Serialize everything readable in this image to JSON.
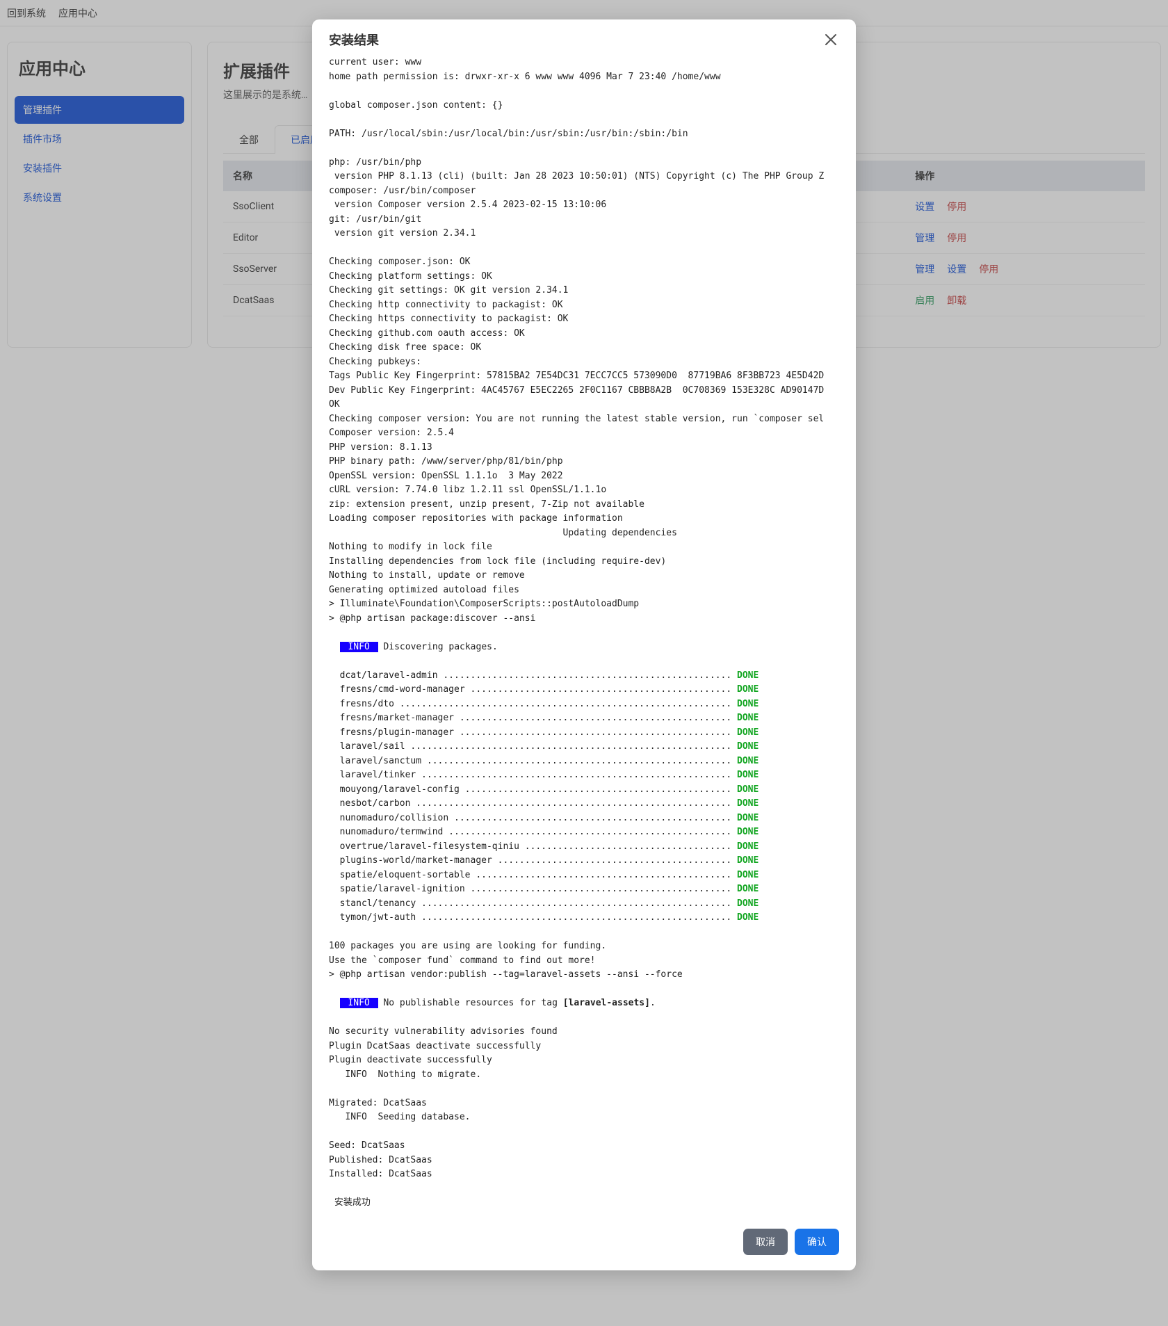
{
  "topbar": {
    "back": "回到系统",
    "app_center": "应用中心"
  },
  "sidebar": {
    "title": "应用中心",
    "items": [
      "管理插件",
      "插件市场",
      "安装插件",
      "系统设置"
    ]
  },
  "content": {
    "title": "扩展插件",
    "desc": "这里展示的是系统…",
    "tabs": [
      "全部",
      "已启用"
    ],
    "table": {
      "headers": [
        "名称",
        "操作"
      ],
      "rows": [
        {
          "name": "SsoClient",
          "ops": [
            {
              "label": "设置",
              "cls": "op-blue"
            },
            {
              "label": "停用",
              "cls": "op-red"
            }
          ]
        },
        {
          "name": "Editor",
          "ops": [
            {
              "label": "管理",
              "cls": "op-blue"
            },
            {
              "label": "停用",
              "cls": "op-red"
            }
          ]
        },
        {
          "name": "SsoServer",
          "ops": [
            {
              "label": "管理",
              "cls": "op-blue"
            },
            {
              "label": "设置",
              "cls": "op-blue"
            },
            {
              "label": "停用",
              "cls": "op-red"
            }
          ]
        },
        {
          "name": "DcatSaas",
          "ops": [
            {
              "label": "启用",
              "cls": "op-green"
            },
            {
              "label": "卸载",
              "cls": "op-red"
            }
          ]
        }
      ]
    }
  },
  "modal": {
    "title": "安装结果",
    "cancel": "取消",
    "ok": "确认",
    "log_head": "current user: www\nhome path permission is: drwxr-xr-x 6 www www 4096 Mar 7 23:40 /home/www\n\nglobal composer.json content: {}\n\nPATH: /usr/local/sbin:/usr/local/bin:/usr/sbin:/usr/bin:/sbin:/bin\n\nphp: /usr/bin/php\n version PHP 8.1.13 (cli) (built: Jan 28 2023 10:50:01) (NTS) Copyright (c) The PHP Group Z\ncomposer: /usr/bin/composer\n version Composer version 2.5.4 2023-02-15 13:10:06\ngit: /usr/bin/git\n version git version 2.34.1\n\nChecking composer.json: OK\nChecking platform settings: OK\nChecking git settings: OK git version 2.34.1\nChecking http connectivity to packagist: OK\nChecking https connectivity to packagist: OK\nChecking github.com oauth access: OK\nChecking disk free space: OK\nChecking pubkeys:\nTags Public Key Fingerprint: 57815BA2 7E54DC31 7ECC7CC5 573090D0  87719BA6 8F3BB723 4E5D42D\nDev Public Key Fingerprint: 4AC45767 E5EC2265 2F0C1167 CBBB8A2B  0C708369 153E328C AD90147D\nOK\nChecking composer version: You are not running the latest stable version, run `composer sel\nComposer version: 2.5.4\nPHP version: 8.1.13\nPHP binary path: /www/server/php/81/bin/php\nOpenSSL version: OpenSSL 1.1.1o  3 May 2022\ncURL version: 7.74.0 libz 1.2.11 ssl OpenSSL/1.1.1o\nzip: extension present, unzip present, 7-Zip not available\nLoading composer repositories with package information\n                                           Updating dependencies\nNothing to modify in lock file\nInstalling dependencies from lock file (including require-dev)\nNothing to install, update or remove\nGenerating optimized autoload files\n> Illuminate\\Foundation\\ComposerScripts::postAutoloadDump\n> @php artisan package:discover --ansi\n",
    "info_discovering": " Discovering packages.",
    "packages": [
      "dcat/laravel-admin .....................................................",
      "fresns/cmd-word-manager ................................................",
      "fresns/dto .............................................................",
      "fresns/market-manager ..................................................",
      "fresns/plugin-manager ..................................................",
      "laravel/sail ...........................................................",
      "laravel/sanctum ........................................................",
      "laravel/tinker .........................................................",
      "mouyong/laravel-config .................................................",
      "nesbot/carbon ..........................................................",
      "nunomaduro/collision ...................................................",
      "nunomaduro/termwind ....................................................",
      "overtrue/laravel-filesystem-qiniu ......................................",
      "plugins-world/market-manager ...........................................",
      "spatie/eloquent-sortable ...............................................",
      "spatie/laravel-ignition ................................................",
      "stancl/tenancy .........................................................",
      "tymon/jwt-auth ........................................................."
    ],
    "done_label": "DONE",
    "log_after_packages": "\n100 packages you are using are looking for funding.\nUse the `composer fund` command to find out more!\n> @php artisan vendor:publish --tag=laravel-assets --ansi --force\n",
    "info_no_publishable_pre": " No publishable resources for tag ",
    "laravel_assets_tag": "[laravel-assets]",
    "info_no_publishable_post": ".",
    "log_tail": "\nNo security vulnerability advisories found\nPlugin DcatSaas deactivate successfully\nPlugin deactivate successfully\n   INFO  Nothing to migrate.\n\nMigrated: DcatSaas\n   INFO  Seeding database.\n\nSeed: DcatSaas\nPublished: DcatSaas\nInstalled: DcatSaas\n\n 安装成功\n",
    "info_label": " INFO "
  }
}
